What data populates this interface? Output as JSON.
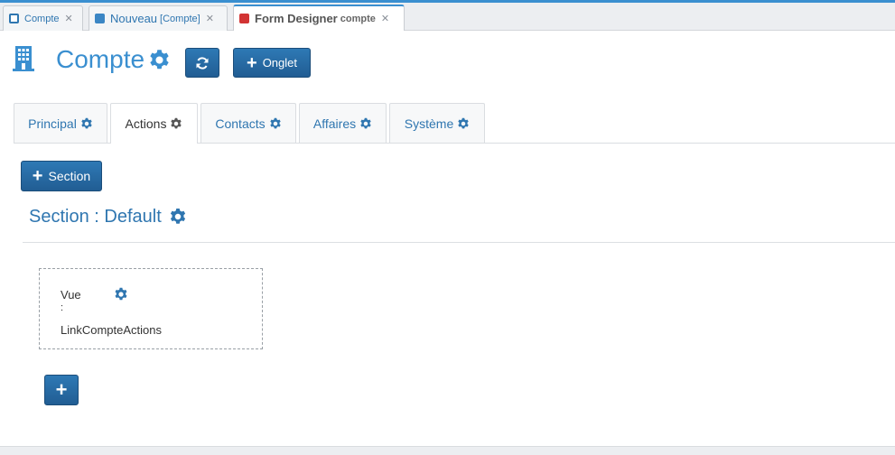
{
  "window_tabs": [
    {
      "label": "Compte",
      "sub": ""
    },
    {
      "label": "Nouveau",
      "sub": "[Compte]"
    },
    {
      "label": "Form Designer",
      "sub": "compte"
    }
  ],
  "header": {
    "title": "Compte",
    "onglet_label": "Onglet"
  },
  "form_tabs": [
    {
      "label": "Principal"
    },
    {
      "label": "Actions"
    },
    {
      "label": "Contacts"
    },
    {
      "label": "Affaires"
    },
    {
      "label": "Système"
    }
  ],
  "section": {
    "add_label": "Section",
    "title": "Section : Default"
  },
  "field": {
    "line1": "Vue",
    "line2": ":",
    "line3": "LinkCompteActions"
  },
  "colors": {
    "accent": "#3a8fd0",
    "button": "#2568a3"
  },
  "icons": [
    "building-icon",
    "gear-icon",
    "refresh-icon",
    "plus-icon",
    "close-icon"
  ]
}
